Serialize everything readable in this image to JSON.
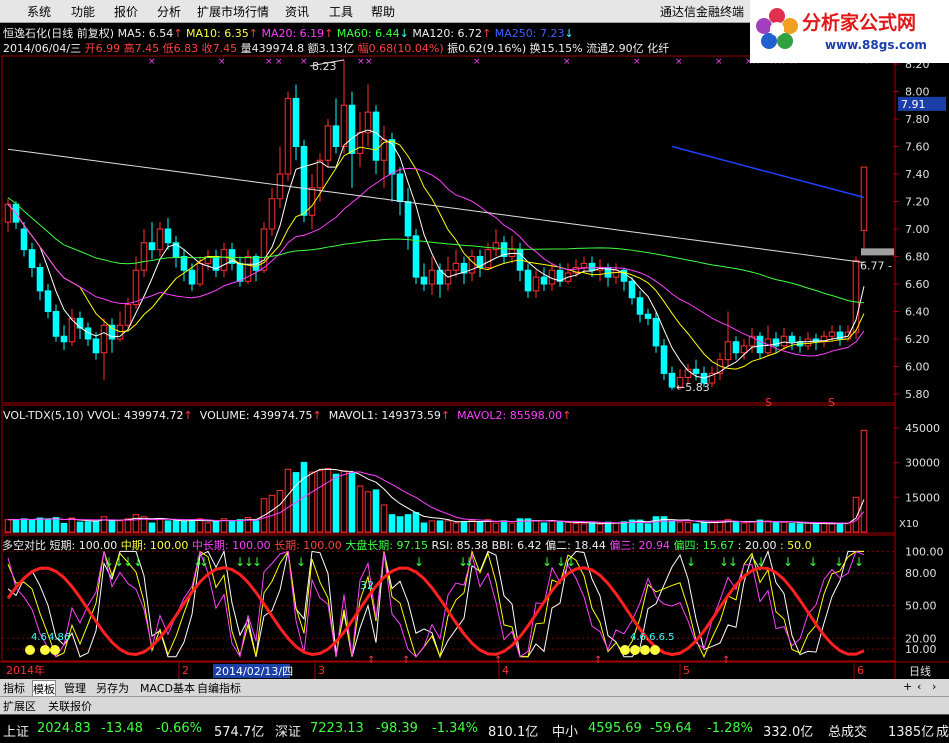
{
  "menu": {
    "items": [
      "系统",
      "功能",
      "报价",
      "分析",
      "扩展市场行情",
      "资讯",
      "工具",
      "帮助"
    ],
    "app_title": "通达信金融终端"
  },
  "logo": {
    "text": "分析家公式网",
    "url": "www.88gs.com"
  },
  "header": {
    "stock": "恒逸石化(日线 前复权)",
    "ma5": "MA5: 6.54",
    "ma10": "MA10: 6.35",
    "ma20": "MA20: 6.19",
    "ma60": "MA60: 6.44",
    "ma120": "MA120: 6.72",
    "ma250": "MA250: 7.23",
    "date": "2014/06/04/三",
    "open": "开6.99",
    "high": "高7.45",
    "low": "低6.83",
    "close": "收7.45",
    "vol": "量439974.8",
    "amount": "额3.13亿",
    "pct": "幅0.68(10.04%)",
    "amp": "振0.62(9.16%)",
    "turn": "换15.15%",
    "float": "流通2.90亿",
    "industry": "化纤"
  },
  "price_axis": [
    "8.20",
    "8.00",
    "7.80",
    "7.60",
    "7.40",
    "7.20",
    "7.00",
    "6.80",
    "6.60",
    "6.40",
    "6.20",
    "6.00",
    "5.80"
  ],
  "price_marker": "7.91",
  "annotations": {
    "high": "8.23",
    "low": "5.83",
    "level": "6.77",
    "s1": "S",
    "s2": "S"
  },
  "volume": {
    "label": "VOL-TDX(5,10)",
    "vvol": "VVOL: 439974.72",
    "volume": "VOLUME: 439974.75",
    "mavol1": "MAVOL1: 149373.59",
    "mavol2": "MAVOL2: 85598.00",
    "axis": [
      "45000",
      "30000",
      "15000"
    ],
    "unit": "X10"
  },
  "indicator": {
    "name": "多空对比",
    "short": "短期: 100.00",
    "mid": "中期: 100.00",
    "midlong": "中长期: 100.00",
    "long": "长期: 100.00",
    "market": "大盘长期: 97.15",
    "rsi": "RSI: 85.38",
    "bbi": "BBI: 6.42",
    "dev2": "偏二: 18.44",
    "dev3": "偏三: 20.94",
    "dev4": "偏四: 15.67",
    "v20": ": 20.00",
    "v50": ": 50.0",
    "axis": [
      "100.00",
      "80.00",
      "50.00",
      "20.00",
      "10.00"
    ],
    "mark1": "4.6",
    "mark2": "4.86",
    "mark3": "32",
    "mark4": "4.6.6.6.5"
  },
  "timeline": {
    "year": "2014年",
    "m2": "2",
    "sel": "2014/02/13/四",
    "m3": "3",
    "m4": "4",
    "m5": "5",
    "m6": "6",
    "period": "日线"
  },
  "tabs": [
    "指标",
    "模板",
    "管理",
    "另存为",
    "MACD基本",
    "自编指标"
  ],
  "zones": [
    "扩展区",
    "关联报价"
  ],
  "status": {
    "sh_label": "上证",
    "sh_val": "2024.83",
    "sh_chg": "-13.48",
    "sh_pct": "-0.66%",
    "sh_amt": "574.7亿",
    "sz_label": "深证",
    "sz_val": "7223.13",
    "sz_chg": "-98.39",
    "sz_pct": "-1.34%",
    "sz_amt": "810.1亿",
    "zx_label": "中小",
    "zx_val": "4595.69",
    "zx_chg": "-59.64",
    "zx_pct": "-1.28%",
    "zx_amt": "332.0亿",
    "total_label": "总成交",
    "total_val": "1385亿",
    "more": "成"
  },
  "colors": {
    "up": "#ff3030",
    "down": "#00ffff",
    "ma5": "#ffffff",
    "ma10": "#ffff00",
    "ma20": "#ff40ff",
    "ma60": "#40ff40",
    "ma120": "#e0e0e0",
    "ma250": "#2040ff",
    "grid": "#a00000"
  },
  "chart_data": {
    "type": "candlestick",
    "candles": [
      [
        7.05,
        7.18,
        7.22,
        6.98
      ],
      [
        7.18,
        7.05,
        7.2,
        7.0
      ],
      [
        7.0,
        6.85,
        7.05,
        6.8
      ],
      [
        6.85,
        6.72,
        6.9,
        6.65
      ],
      [
        6.72,
        6.55,
        6.75,
        6.48
      ],
      [
        6.55,
        6.4,
        6.6,
        6.35
      ],
      [
        6.4,
        6.22,
        6.45,
        6.18
      ],
      [
        6.22,
        6.18,
        6.3,
        6.12
      ],
      [
        6.18,
        6.35,
        6.42,
        6.15
      ],
      [
        6.35,
        6.28,
        6.4,
        6.2
      ],
      [
        6.28,
        6.2,
        6.32,
        6.15
      ],
      [
        6.2,
        6.1,
        6.25,
        6.05
      ],
      [
        6.1,
        6.3,
        6.35,
        5.9
      ],
      [
        6.3,
        6.2,
        6.35,
        6.1
      ],
      [
        6.2,
        6.3,
        6.4,
        6.18
      ],
      [
        6.3,
        6.45,
        6.5,
        6.28
      ],
      [
        6.45,
        6.7,
        6.8,
        6.42
      ],
      [
        6.7,
        6.9,
        7.0,
        6.65
      ],
      [
        6.9,
        6.85,
        7.05,
        6.78
      ],
      [
        6.85,
        7.0,
        7.05,
        6.8
      ],
      [
        7.0,
        6.9,
        7.08,
        6.85
      ],
      [
        6.9,
        6.8,
        6.95,
        6.72
      ],
      [
        6.8,
        6.7,
        6.85,
        6.62
      ],
      [
        6.7,
        6.6,
        6.75,
        6.55
      ],
      [
        6.6,
        6.75,
        6.8,
        6.58
      ],
      [
        6.75,
        6.8,
        6.85,
        6.7
      ],
      [
        6.8,
        6.7,
        6.85,
        6.65
      ],
      [
        6.7,
        6.85,
        6.9,
        6.65
      ],
      [
        6.85,
        6.75,
        6.9,
        6.7
      ],
      [
        6.75,
        6.62,
        6.8,
        6.58
      ],
      [
        6.62,
        6.8,
        6.85,
        6.6
      ],
      [
        6.8,
        6.7,
        6.82,
        6.62
      ],
      [
        6.7,
        7.0,
        7.05,
        6.68
      ],
      [
        7.0,
        7.22,
        7.3,
        6.95
      ],
      [
        7.22,
        7.4,
        7.6,
        7.15
      ],
      [
        7.4,
        7.95,
        8.0,
        7.35
      ],
      [
        7.95,
        7.6,
        8.05,
        7.5
      ],
      [
        7.6,
        7.1,
        7.65,
        7.05
      ],
      [
        7.1,
        7.3,
        7.4,
        7.0
      ],
      [
        7.3,
        7.5,
        7.55,
        7.2
      ],
      [
        7.5,
        7.75,
        7.8,
        7.45
      ],
      [
        7.75,
        7.6,
        7.95,
        7.55
      ],
      [
        7.6,
        7.9,
        8.23,
        7.55
      ],
      [
        7.9,
        7.55,
        8.0,
        7.3
      ],
      [
        7.55,
        7.7,
        7.85,
        7.45
      ],
      [
        7.7,
        7.85,
        8.05,
        7.6
      ],
      [
        7.85,
        7.5,
        7.9,
        7.4
      ],
      [
        7.5,
        7.65,
        7.75,
        7.3
      ],
      [
        7.65,
        7.4,
        7.7,
        7.2
      ],
      [
        7.4,
        7.2,
        7.45,
        7.1
      ],
      [
        7.2,
        6.95,
        7.3,
        6.85
      ],
      [
        6.95,
        6.65,
        7.0,
        6.6
      ],
      [
        6.65,
        6.6,
        6.75,
        6.55
      ],
      [
        6.6,
        6.7,
        6.8,
        6.52
      ],
      [
        6.7,
        6.6,
        6.75,
        6.5
      ],
      [
        6.6,
        6.7,
        6.8,
        6.55
      ],
      [
        6.7,
        6.75,
        6.85,
        6.65
      ],
      [
        6.75,
        6.68,
        6.8,
        6.6
      ],
      [
        6.68,
        6.8,
        6.85,
        6.62
      ],
      [
        6.8,
        6.72,
        6.85,
        6.65
      ],
      [
        6.72,
        6.85,
        6.9,
        6.7
      ],
      [
        6.85,
        6.9,
        7.0,
        6.8
      ],
      [
        6.9,
        6.8,
        6.95,
        6.75
      ],
      [
        6.8,
        6.85,
        6.95,
        6.75
      ],
      [
        6.85,
        6.7,
        6.9,
        6.62
      ],
      [
        6.7,
        6.55,
        6.75,
        6.5
      ],
      [
        6.55,
        6.65,
        6.7,
        6.5
      ],
      [
        6.65,
        6.6,
        6.72,
        6.55
      ],
      [
        6.6,
        6.7,
        6.75,
        6.55
      ],
      [
        6.7,
        6.62,
        6.75,
        6.58
      ],
      [
        6.62,
        6.68,
        6.75,
        6.6
      ],
      [
        6.68,
        6.72,
        6.78,
        6.65
      ],
      [
        6.72,
        6.75,
        6.8,
        6.68
      ],
      [
        6.75,
        6.7,
        6.8,
        6.65
      ],
      [
        6.7,
        6.72,
        6.78,
        6.62
      ],
      [
        6.72,
        6.65,
        6.75,
        6.58
      ],
      [
        6.65,
        6.7,
        6.75,
        6.6
      ],
      [
        6.7,
        6.62,
        6.72,
        6.55
      ],
      [
        6.62,
        6.5,
        6.65,
        6.45
      ],
      [
        6.5,
        6.38,
        6.55,
        6.32
      ],
      [
        6.38,
        6.35,
        6.42,
        6.3
      ],
      [
        6.35,
        6.15,
        6.4,
        6.1
      ],
      [
        6.15,
        5.95,
        6.2,
        5.9
      ],
      [
        5.95,
        5.85,
        6.0,
        5.83
      ],
      [
        5.85,
        5.92,
        5.98,
        5.83
      ],
      [
        5.92,
        5.98,
        6.02,
        5.88
      ],
      [
        5.98,
        5.95,
        6.05,
        5.9
      ],
      [
        5.95,
        5.88,
        6.0,
        5.85
      ],
      [
        5.88,
        5.95,
        6.0,
        5.85
      ],
      [
        5.95,
        6.05,
        6.1,
        5.9
      ],
      [
        6.05,
        6.18,
        6.4,
        6.0
      ],
      [
        6.18,
        6.1,
        6.22,
        6.05
      ],
      [
        6.1,
        6.15,
        6.2,
        6.05
      ],
      [
        6.15,
        6.22,
        6.28,
        6.1
      ],
      [
        6.22,
        6.1,
        6.25,
        6.05
      ],
      [
        6.1,
        6.2,
        6.3,
        6.08
      ],
      [
        6.2,
        6.15,
        6.25,
        6.1
      ],
      [
        6.15,
        6.22,
        6.28,
        6.12
      ],
      [
        6.22,
        6.18,
        6.25,
        6.12
      ],
      [
        6.18,
        6.15,
        6.22,
        6.1
      ],
      [
        6.15,
        6.2,
        6.25,
        6.12
      ],
      [
        6.2,
        6.18,
        6.24,
        6.12
      ],
      [
        6.18,
        6.22,
        6.26,
        6.14
      ],
      [
        6.22,
        6.25,
        6.3,
        6.18
      ],
      [
        6.25,
        6.2,
        6.3,
        6.15
      ],
      [
        6.2,
        6.25,
        6.3,
        6.18
      ],
      [
        6.25,
        6.77,
        6.8,
        6.2
      ],
      [
        6.99,
        7.45,
        7.45,
        6.83
      ]
    ],
    "volume_max": 45000
  }
}
